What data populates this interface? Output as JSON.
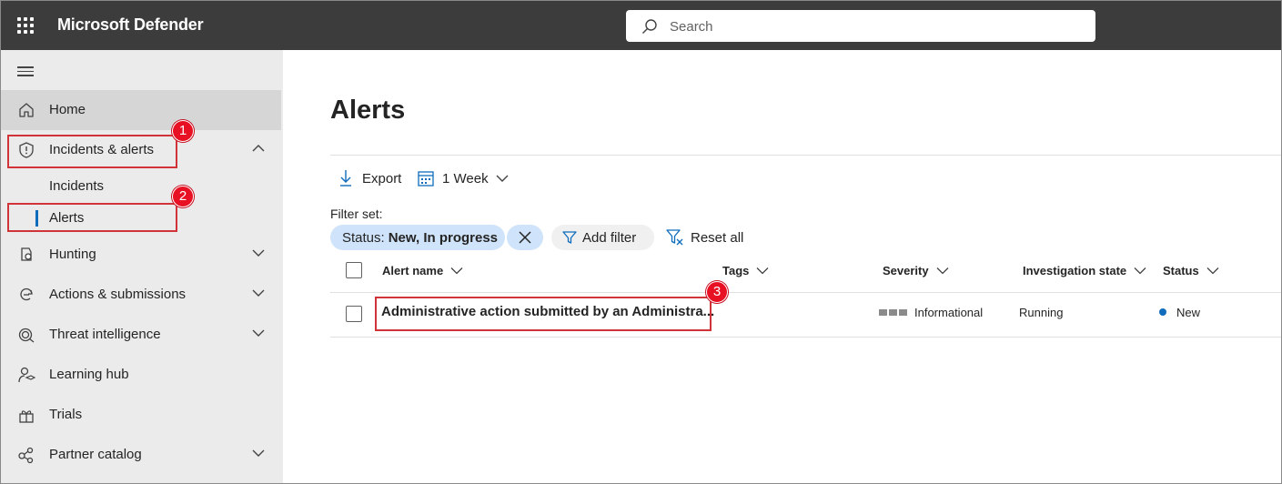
{
  "app": {
    "title": "Microsoft Defender"
  },
  "search": {
    "placeholder": "Search"
  },
  "sidebar": {
    "items": [
      {
        "label": "Home",
        "icon": "home-icon"
      },
      {
        "label": "Incidents & alerts",
        "icon": "shield-icon",
        "expanded": true
      },
      {
        "label": "Incidents"
      },
      {
        "label": "Alerts",
        "selected": true
      },
      {
        "label": "Hunting",
        "icon": "hunting-icon"
      },
      {
        "label": "Actions & submissions",
        "icon": "actions-icon"
      },
      {
        "label": "Threat intelligence",
        "icon": "threat-intel-icon"
      },
      {
        "label": "Learning hub",
        "icon": "learning-icon"
      },
      {
        "label": "Trials",
        "icon": "trials-icon"
      },
      {
        "label": "Partner catalog",
        "icon": "partner-icon"
      }
    ]
  },
  "callouts": [
    "1",
    "2",
    "3"
  ],
  "main": {
    "title": "Alerts",
    "toolbar": {
      "export_label": "Export",
      "range_label": "1 Week"
    },
    "filter_set_label": "Filter set:",
    "filter_pill": {
      "prefix": "Status:",
      "value": "New, In progress"
    },
    "add_filter_label": "Add filter",
    "reset_label": "Reset all",
    "table": {
      "columns": [
        "Alert name",
        "Tags",
        "Severity",
        "Investigation state",
        "Status"
      ],
      "rows": [
        {
          "name": "Administrative action submitted by an Administra...",
          "tags": "",
          "severity": "Informational",
          "investigation_state": "Running",
          "status": "New"
        }
      ]
    }
  },
  "colors": {
    "topbar": "#3c3c3c",
    "sidebar": "#ebebeb",
    "accent": "#0f6cbd",
    "callout": "#e81123",
    "pill": "#cfe4fa"
  }
}
